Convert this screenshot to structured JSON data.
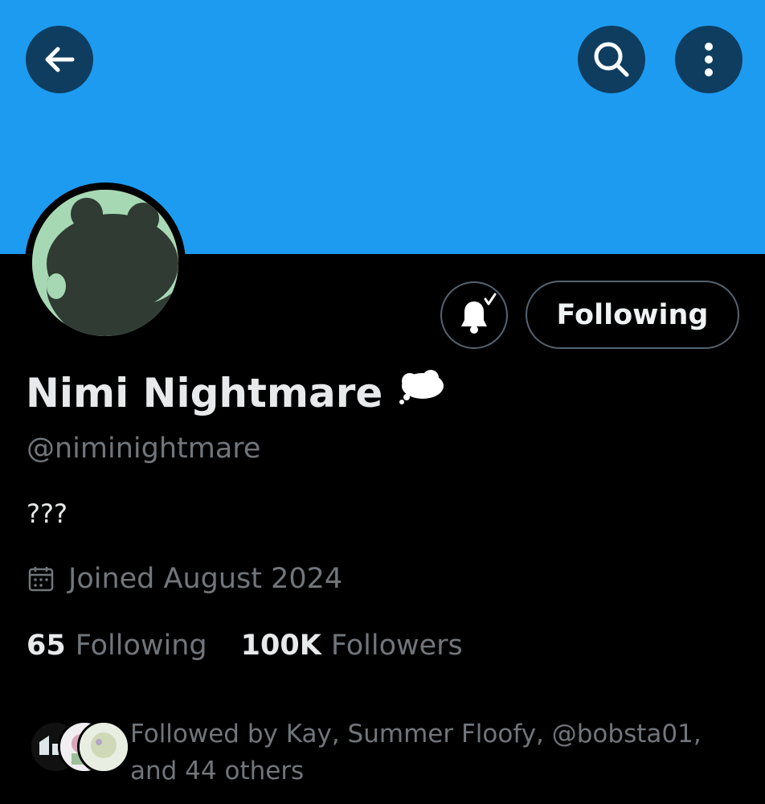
{
  "header": {
    "back_icon": "arrow-left-icon",
    "search_icon": "search-icon",
    "more_icon": "more-vertical-icon",
    "banner_color": "#1d9bf0",
    "button_color": "#0f3d5f"
  },
  "profile": {
    "display_name": "Nimi Nightmare",
    "name_emoji": "thought-balloon-icon",
    "handle": "@niminightmare",
    "bio": "???",
    "joined": "Joined August 2024",
    "avatar_icon": "silhouette-avatar"
  },
  "actions": {
    "notifications_icon": "bell-check-icon",
    "follow_label": "Following"
  },
  "stats": {
    "following_count": "65",
    "following_label": "Following",
    "followers_count": "100K",
    "followers_label": "Followers"
  },
  "followed_by": {
    "text": "Followed by Kay, Summer Floofy, @bobsta01, and 44 others"
  },
  "colors": {
    "background": "#000000",
    "text_primary": "#e7e9ea",
    "text_secondary": "#71767b",
    "border": "#536471",
    "avatar_bg": "#a6d8b4",
    "avatar_silhouette": "#2f3b33"
  }
}
